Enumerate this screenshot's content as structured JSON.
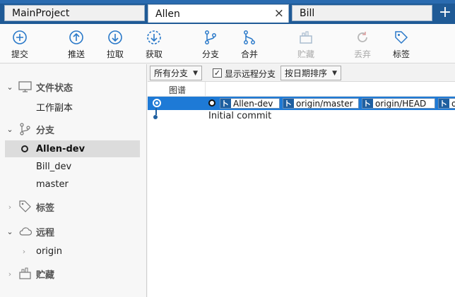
{
  "tabs": [
    {
      "label": "MainProject"
    },
    {
      "label": "Allen"
    },
    {
      "label": "Bill"
    }
  ],
  "new_tab_label": "+",
  "close_glyph": "×",
  "toolbar": {
    "commit": "提交",
    "push": "推送",
    "pull": "拉取",
    "fetch": "获取",
    "branch": "分支",
    "merge": "合并",
    "stash": "贮藏",
    "discard": "丢弃",
    "tag": "标签"
  },
  "sidebar": {
    "workspace_header": "文件状态",
    "working_copy": "工作副本",
    "branches_header": "分支",
    "branches": [
      "Allen-dev",
      "Bill_dev",
      "master"
    ],
    "tags_header": "标签",
    "remotes_header": "远程",
    "remotes": [
      "origin"
    ],
    "stashes_header": "贮藏"
  },
  "filter": {
    "branch_scope": "所有分支",
    "show_remote_label": "显示远程分支",
    "show_remote_checked": true,
    "sort": "按日期排序"
  },
  "columns": {
    "graph": "图谱"
  },
  "commits": [
    {
      "refs": [
        "Allen-dev",
        "origin/master",
        "origin/HEAD",
        "o"
      ],
      "selected": true
    },
    {
      "message": "Initial commit"
    }
  ],
  "colors": {
    "accent": "#1e7ad6",
    "tabbar": "#1f5a96"
  }
}
